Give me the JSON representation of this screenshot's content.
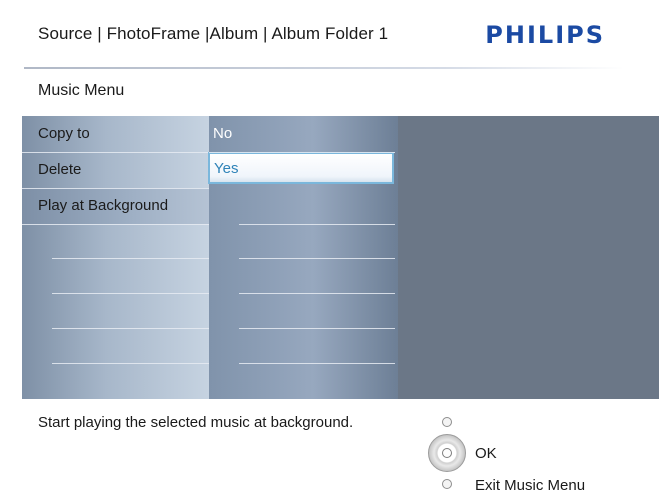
{
  "header": {
    "breadcrumb": "Source | FhotoFrame |Album | Album Folder 1",
    "logo": "PHILIPS"
  },
  "section_title": "Music Menu",
  "menu": {
    "items": [
      {
        "label": "Copy to",
        "selected": false
      },
      {
        "label": "Delete",
        "selected": false
      },
      {
        "label": "Play at Background",
        "selected": true
      }
    ]
  },
  "options": {
    "items": [
      {
        "label": "No",
        "highlighted": false
      },
      {
        "label": "Yes",
        "highlighted": true
      }
    ]
  },
  "footer": {
    "hint": "Start playing the selected music at background.",
    "ok_label": "OK",
    "exit_label": "Exit Music Menu"
  },
  "colors": {
    "logo": "#1b4aa3",
    "panel_background": "#6b7787",
    "highlight_text": "#2e83b8",
    "highlight_border": "#7ab7dc"
  }
}
